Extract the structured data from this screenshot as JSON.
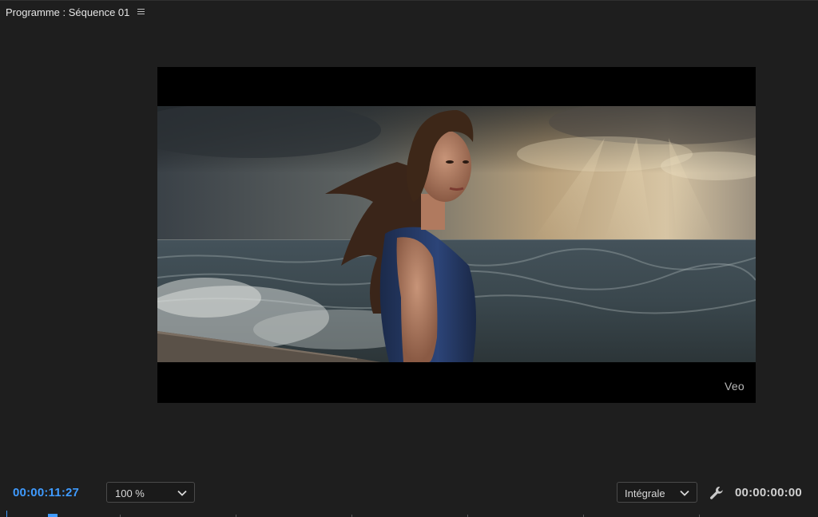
{
  "panel": {
    "title": "Programme : Séquence 01",
    "menu_icon": "hamburger-menu-icon"
  },
  "viewer": {
    "watermark": "Veo",
    "image_description_icon": "video-frame"
  },
  "controls": {
    "current_timecode": "00:00:11:27",
    "zoom_value": "100 %",
    "quality_value": "Intégrale",
    "settings_icon": "wrench-icon",
    "duration_timecode": "00:00:00:00"
  },
  "colors": {
    "accent": "#3f9bff",
    "background": "#1e1e1e"
  }
}
